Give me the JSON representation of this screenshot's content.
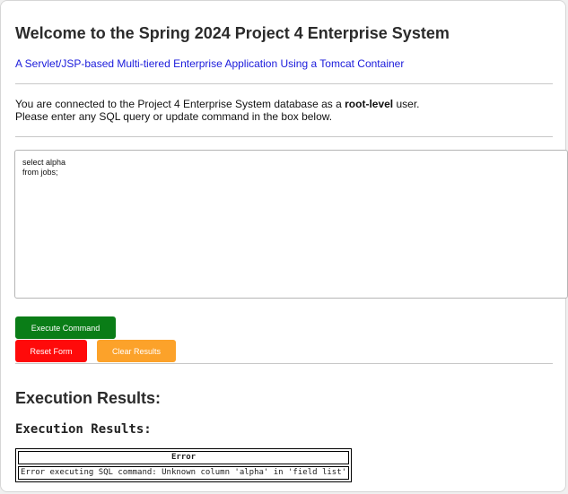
{
  "header": {
    "title": "Welcome to the Spring 2024 Project 4 Enterprise System",
    "subtitle": "A Servlet/JSP-based Multi-tiered Enterprise Application Using a Tomcat Container"
  },
  "connection_info": {
    "prefix": "You are connected to the Project 4 Enterprise System database as a ",
    "role": "root-level",
    "suffix": " user.",
    "instruction": "Please enter any SQL query or update command in the box below."
  },
  "query_box": {
    "value": "select alpha\nfrom jobs;"
  },
  "buttons": {
    "execute_label": "Execute Command",
    "reset_label": "Reset Form",
    "clear_label": "Clear Results"
  },
  "results": {
    "heading": "Execution Results:",
    "subheading": "Execution Results:",
    "table_header": "Error",
    "table_message": "Error executing SQL command: Unknown column 'alpha' in 'field list'"
  },
  "colors": {
    "execute_button": "#0a7d17",
    "reset_button": "#ff0a0a",
    "clear_button": "#fca22a",
    "subtitle_link": "#1a1adb"
  }
}
